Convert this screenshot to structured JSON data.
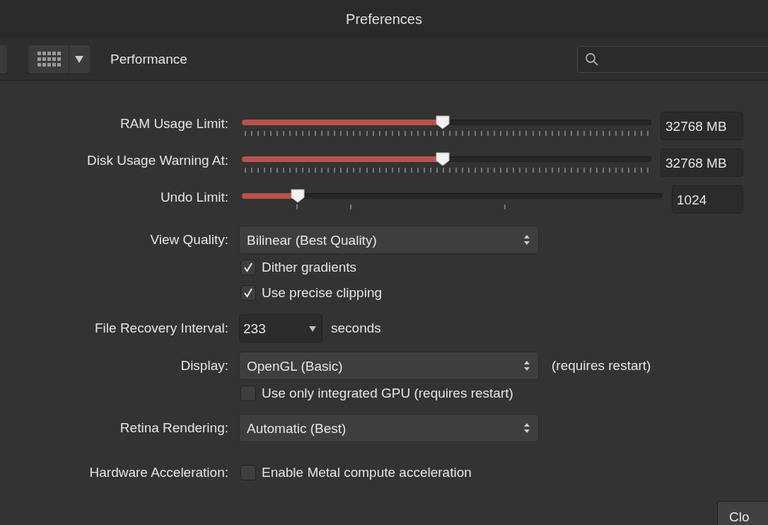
{
  "window": {
    "title": "Preferences"
  },
  "toolbar": {
    "section": "Performance"
  },
  "rows": [
    {
      "kind": "slider",
      "label": "RAM Usage Limit:",
      "level": 0.49,
      "value": "32768 MB"
    },
    {
      "kind": "slider",
      "label": "Disk Usage Warning At:",
      "level": 0.49,
      "value": "32768 MB"
    },
    {
      "kind": "stepslider",
      "label": "Undo Limit:",
      "level": 0.133,
      "value": "1024"
    },
    {
      "kind": "select",
      "label": "View Quality:",
      "value": "Bilinear (Best Quality)"
    },
    {
      "kind": "checkbox",
      "text": "Dither gradients",
      "checked": true
    },
    {
      "kind": "checkbox",
      "text": "Use precise clipping",
      "checked": true
    },
    {
      "kind": "combo",
      "label": "File Recovery Interval:",
      "value": "233",
      "suffix": "seconds"
    },
    {
      "kind": "select",
      "label": "Display:",
      "value": "OpenGL (Basic)",
      "note": "(requires restart)"
    },
    {
      "kind": "checkbox",
      "text": "Use only integrated GPU (requires restart)",
      "checked": false
    },
    {
      "kind": "select",
      "label": "Retina Rendering:",
      "value": "Automatic (Best)"
    },
    {
      "kind": "checkbox",
      "label": "Hardware Acceleration:",
      "text": "Enable Metal compute acceleration",
      "checked": false
    }
  ],
  "footer": {
    "button": "Clo"
  }
}
